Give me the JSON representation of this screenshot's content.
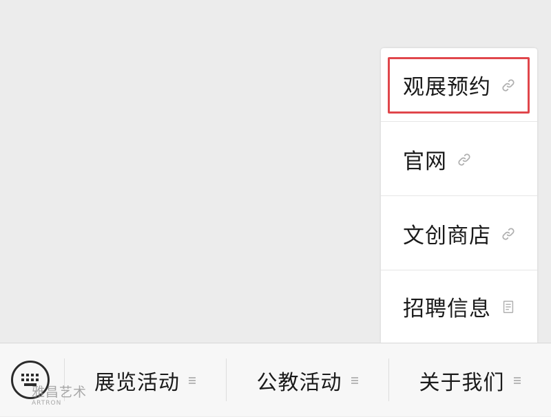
{
  "submenu": {
    "items": [
      {
        "label": "观展预约",
        "icon": "link-icon",
        "highlighted": true
      },
      {
        "label": "官网",
        "icon": "link-icon",
        "highlighted": false
      },
      {
        "label": "文创商店",
        "icon": "link-icon",
        "highlighted": false
      },
      {
        "label": "招聘信息",
        "icon": "document-icon",
        "highlighted": false
      }
    ],
    "highlight_color": "#e0464b"
  },
  "menu_bar": {
    "keyboard_icon": "keyboard-icon",
    "items": [
      {
        "label": "展览活动",
        "icon": "menu-list-icon"
      },
      {
        "label": "公教活动",
        "icon": "menu-list-icon"
      },
      {
        "label": "关于我们",
        "icon": "menu-list-icon"
      }
    ]
  },
  "watermark": {
    "text": "雅昌艺术",
    "subtext": "ARTRON"
  }
}
